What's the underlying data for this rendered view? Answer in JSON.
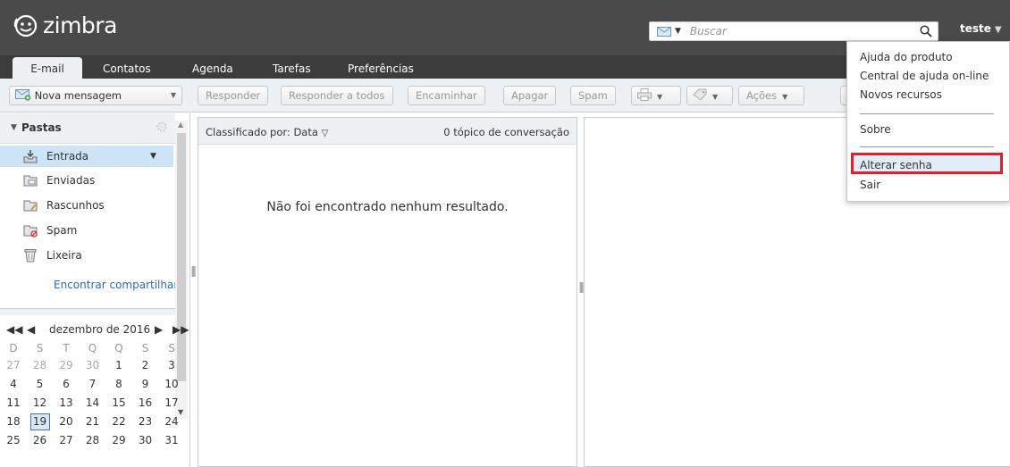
{
  "app": {
    "logo_text": "zimbra",
    "user_label": "teste"
  },
  "search": {
    "placeholder": "Buscar"
  },
  "tabs": [
    {
      "label": "E-mail"
    },
    {
      "label": "Contatos"
    },
    {
      "label": "Agenda"
    },
    {
      "label": "Tarefas"
    },
    {
      "label": "Preferências"
    }
  ],
  "toolbar": {
    "new_message": "Nova mensagem",
    "reply": "Responder",
    "reply_all": "Responder a todos",
    "forward": "Encaminhar",
    "delete": "Apagar",
    "spam": "Spam",
    "actions": "Ações"
  },
  "folders": {
    "title": "Pastas",
    "items": [
      {
        "label": "Entrada",
        "icon": "inbox-icon"
      },
      {
        "label": "Enviadas",
        "icon": "sent-icon"
      },
      {
        "label": "Rascunhos",
        "icon": "drafts-icon"
      },
      {
        "label": "Spam",
        "icon": "spam-folder-icon"
      },
      {
        "label": "Lixeira",
        "icon": "trash-icon"
      }
    ],
    "find_shares": "Encontrar compartilhar"
  },
  "calendar": {
    "month_label": "dezembro de 2016",
    "weekdays": [
      "D",
      "S",
      "T",
      "Q",
      "Q",
      "S",
      "S"
    ],
    "weeks": [
      [
        "27",
        "28",
        "29",
        "30",
        "1",
        "2",
        "3"
      ],
      [
        "4",
        "5",
        "6",
        "7",
        "8",
        "9",
        "10"
      ],
      [
        "11",
        "12",
        "13",
        "14",
        "15",
        "16",
        "17"
      ],
      [
        "18",
        "19",
        "20",
        "21",
        "22",
        "23",
        "24"
      ],
      [
        "25",
        "26",
        "27",
        "28",
        "29",
        "30",
        "31"
      ]
    ],
    "today": "19"
  },
  "list": {
    "sort_label": "Classificado por: Data",
    "count_label": "0 tópico de conversação",
    "empty_message": "Não foi encontrado nenhum resultado."
  },
  "user_menu": {
    "items": [
      "Ajuda do produto",
      "Central de ajuda on-line",
      "Novos recursos",
      "Sobre",
      "Alterar senha",
      "Sair"
    ]
  },
  "colors": {
    "header_bg": "#4a4a4a",
    "toolbar_bg": "#eef1f4",
    "highlight_border": "#e21e26",
    "selected_folder": "#cde4f7",
    "link": "#2c6bb3"
  }
}
